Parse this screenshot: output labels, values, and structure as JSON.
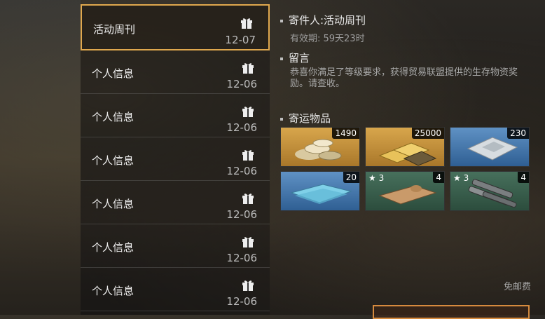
{
  "mail_list": [
    {
      "title": "活动周刊",
      "date": "12-07",
      "selected": true
    },
    {
      "title": "个人信息",
      "date": "12-06"
    },
    {
      "title": "个人信息",
      "date": "12-06"
    },
    {
      "title": "个人信息",
      "date": "12-06"
    },
    {
      "title": "个人信息",
      "date": "12-06"
    },
    {
      "title": "个人信息",
      "date": "12-06"
    },
    {
      "title": "个人信息",
      "date": "12-06"
    }
  ],
  "detail": {
    "sender": "寄件人:活动周刊",
    "validity": "有效期: 59天23时",
    "message_heading": "留言",
    "message_body": "恭喜你满足了等级要求，获得贸易联盟提供的生存物资奖励。请查收。",
    "items_heading": "寄运物品",
    "postage": "免邮费"
  },
  "items": [
    {
      "icon": "coins-icon",
      "quantity": "1490",
      "rarity": "gold"
    },
    {
      "icon": "gold-bars-icon",
      "quantity": "25000",
      "rarity": "gold"
    },
    {
      "icon": "supply-pack-icon",
      "quantity": "230",
      "rarity": "blue"
    },
    {
      "icon": "blueprint-icon",
      "quantity": "20",
      "rarity": "blue"
    },
    {
      "icon": "cloth-roll-icon",
      "quantity": "4",
      "stars": "3",
      "rarity": "green"
    },
    {
      "icon": "pipes-icon",
      "quantity": "4",
      "stars": "3",
      "rarity": "green"
    }
  ],
  "colors": {
    "selected_border": "#e0a84e",
    "gold_tier": "#d8a64c",
    "blue_tier": "#5f91c4",
    "green_tier": "#47705c",
    "button_border": "#d68a3e"
  }
}
